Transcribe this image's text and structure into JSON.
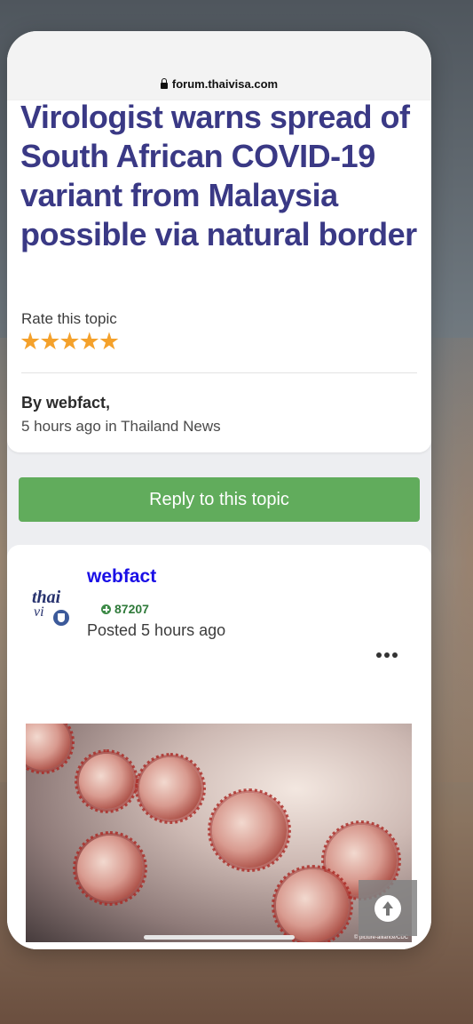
{
  "browser": {
    "url": "forum.thaivisa.com"
  },
  "topic": {
    "title": "Virologist warns spread of South African COVID-19 variant from Malaysia possible via natural border",
    "rate_label": "Rate this topic",
    "rating": 5,
    "rating_stars": "★★★★★",
    "author_line": "By webfact,",
    "meta_line": "5 hours ago in Thailand News"
  },
  "actions": {
    "reply_label": "Reply to this topic"
  },
  "post": {
    "author": "webfact",
    "reputation": "87207",
    "posted": "Posted 5 hours ago",
    "avatar_text_top": "thai",
    "avatar_text_bottom": "vi",
    "image_credit": "© picture-alliance/CDC"
  },
  "colors": {
    "title": "#3a3985",
    "stars": "#f4a12b",
    "reply_button": "#61ac5c",
    "author_link": "#1a0fe6",
    "reputation": "#2f7a3a"
  }
}
